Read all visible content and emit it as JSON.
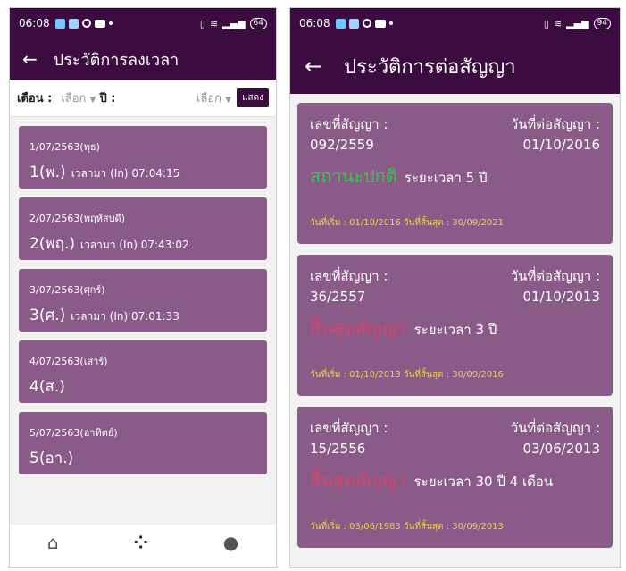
{
  "left": {
    "status_time": "06:08",
    "battery": "64",
    "title": "ประวัติการลงเวลา",
    "filter": {
      "month_label": "เดือน :",
      "month_value": "เลือก",
      "year_label": "ปี :",
      "year_value": "เลือก",
      "show_button": "แสดง"
    },
    "items": [
      {
        "date": "1/07/2563(พุธ)",
        "day": "1(พ.)",
        "time": "เวลามา (In) 07:04:15"
      },
      {
        "date": "2/07/2563(พฤหัสบดี)",
        "day": "2(พฤ.)",
        "time": "เวลามา (In) 07:43:02"
      },
      {
        "date": "3/07/2563(ศุกร์)",
        "day": "3(ศ.)",
        "time": "เวลามา (In) 07:01:33"
      },
      {
        "date": "4/07/2563(เสาร์)",
        "day": "4(ส.)",
        "time": ""
      },
      {
        "date": "5/07/2563(อาทิตย์)",
        "day": "5(อา.)",
        "time": ""
      }
    ],
    "nav": {
      "home": "home-icon",
      "apps": "grid-icon",
      "profile": "person-icon"
    },
    "sysnav": {
      "menu": "≡",
      "home": "□",
      "back": "◁"
    }
  },
  "right": {
    "status_time": "06:08",
    "battery": "94",
    "title": "ประวัติการต่อสัญญา",
    "contract_label": "เลขที่สัญญา :",
    "renew_label": "วันที่ต่อสัญญา :",
    "cards": [
      {
        "number": "092/2559",
        "renew_date": "01/10/2016",
        "status": "สถานะปกติ",
        "status_color": "#3fbf5a",
        "period": "ระยะเวลา 5 ปี",
        "range": "วันที่เริ่ม : 01/10/2016 วันที่สิ้นสุด : 30/09/2021"
      },
      {
        "number": "36/2557",
        "renew_date": "01/10/2013",
        "status": "สิ้นสุดสัญญา",
        "status_color": "#d9436a",
        "period": "ระยะเวลา 3 ปี",
        "range": "วันที่เริ่ม : 01/10/2013 วันที่สิ้นสุด : 30/09/2016"
      },
      {
        "number": "15/2556",
        "renew_date": "03/06/2013",
        "status": "สิ้นสุดสัญญา",
        "status_color": "#d9436a",
        "period": "ระยะเวลา 30 ปี 4 เดือน",
        "range": "วันที่เริ่ม : 03/06/1983 วันที่สิ้นสุด : 30/09/2013"
      }
    ]
  },
  "colors": {
    "primary": "#3c0b3f",
    "card": "#8a5b88",
    "range_text": "#f0d040"
  }
}
